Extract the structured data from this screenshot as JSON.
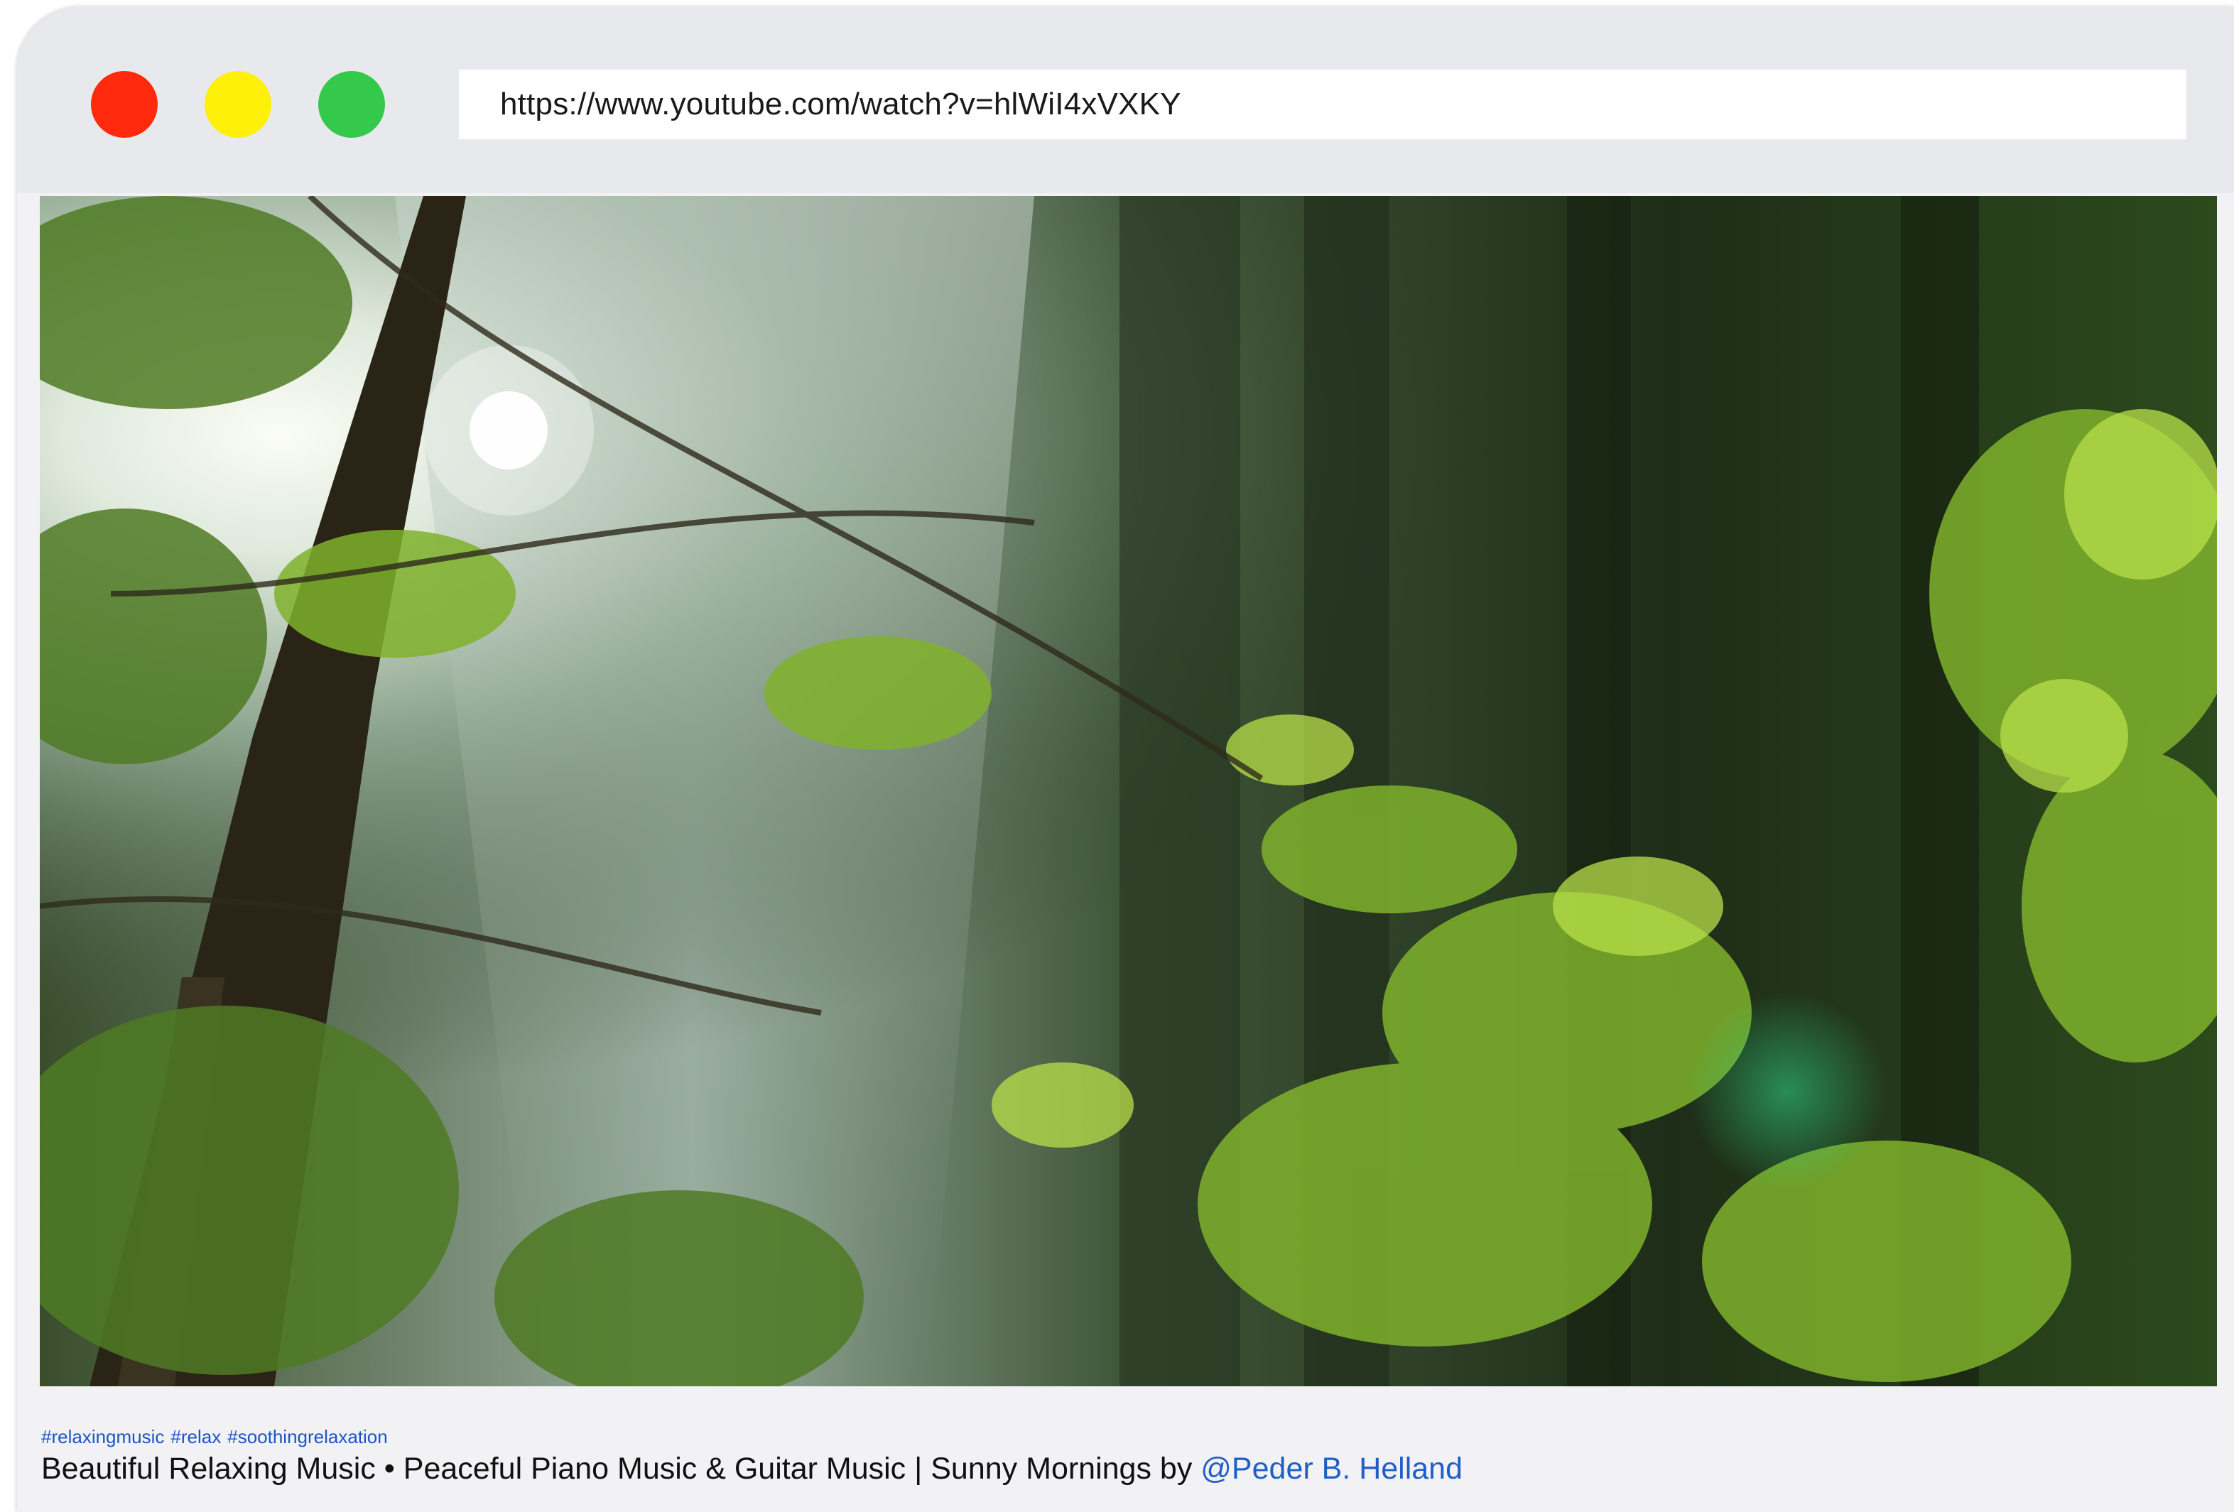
{
  "browser": {
    "url": "https://www.youtube.com/watch?v=hlWiI4xVXKY",
    "traffic_lights": [
      "close",
      "minimize",
      "zoom"
    ],
    "colors": {
      "close": "#ff2a0e",
      "minimize": "#fff00a",
      "zoom": "#35c94b"
    }
  },
  "video": {
    "thumbnail_description_icon": "forest-sunlight-image"
  },
  "description": {
    "hashtags": [
      "#relaxingmusic",
      "#relax",
      "#soothingrelaxation"
    ],
    "title_text": "Beautiful Relaxing Music • Peaceful Piano Music & Guitar Music | Sunny Mornings by ",
    "author_mention": "@Peder B. Helland",
    "link_color": "#1f5ec8"
  }
}
